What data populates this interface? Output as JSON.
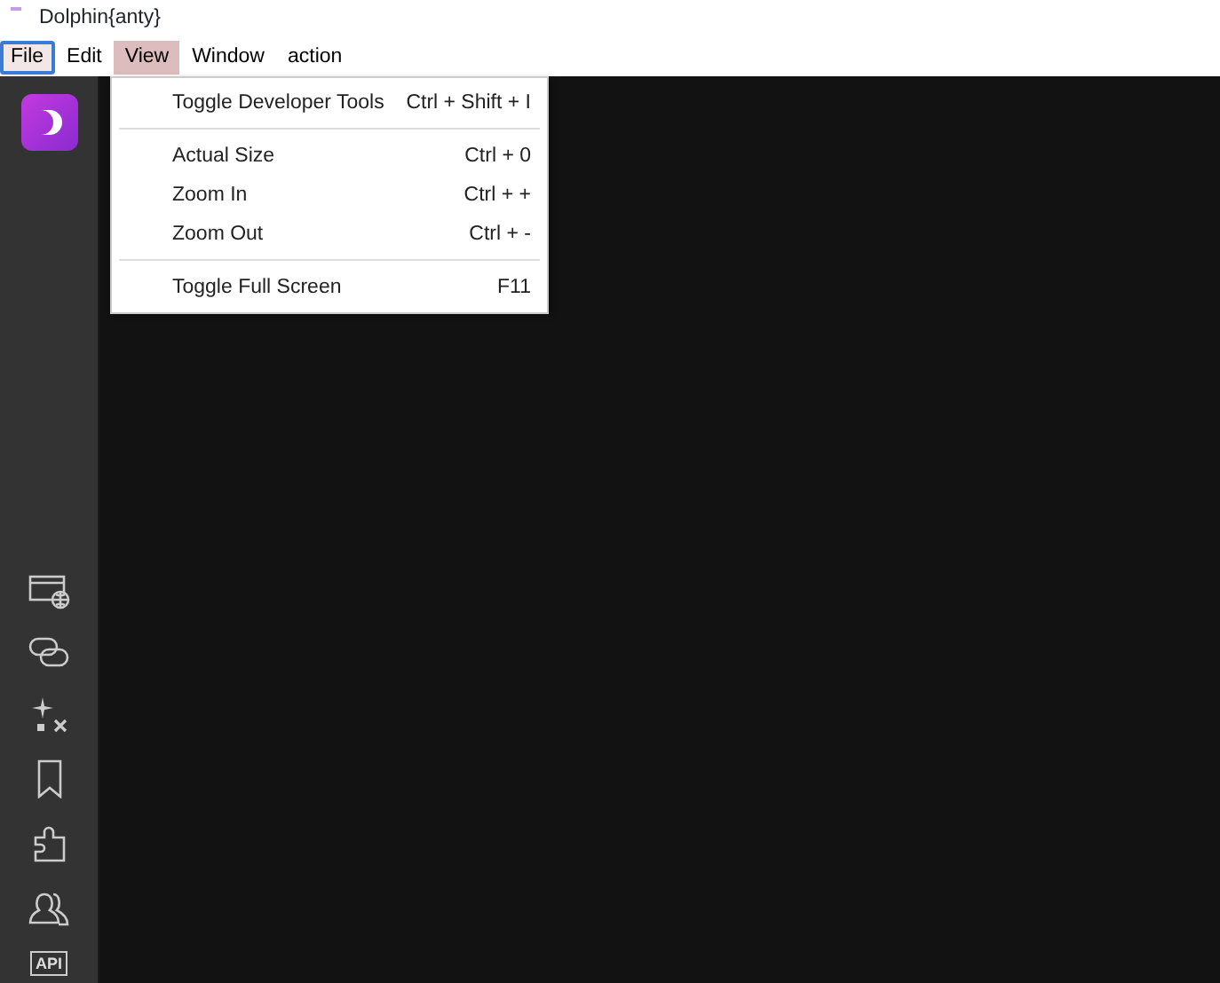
{
  "window": {
    "title": "Dolphin{anty}"
  },
  "menu_bar": [
    {
      "label": "File",
      "selected": false,
      "focused": true
    },
    {
      "label": "Edit",
      "selected": false,
      "focused": false
    },
    {
      "label": "View",
      "selected": true,
      "focused": false
    },
    {
      "label": "Window",
      "selected": false,
      "focused": false
    },
    {
      "label": "action",
      "selected": false,
      "focused": false
    }
  ],
  "view_menu": [
    {
      "kind": "item",
      "label": "Toggle Developer Tools",
      "shortcut": "Ctrl + Shift + I"
    },
    {
      "kind": "separator"
    },
    {
      "kind": "item",
      "label": "Actual Size",
      "shortcut": "Ctrl + 0"
    },
    {
      "kind": "item",
      "label": "Zoom In",
      "shortcut": "Ctrl + +"
    },
    {
      "kind": "item",
      "label": "Zoom Out",
      "shortcut": "Ctrl + -"
    },
    {
      "kind": "separator"
    },
    {
      "kind": "item",
      "label": "Toggle Full Screen",
      "shortcut": "F11"
    }
  ],
  "sidebar": {
    "api_label": "API"
  }
}
